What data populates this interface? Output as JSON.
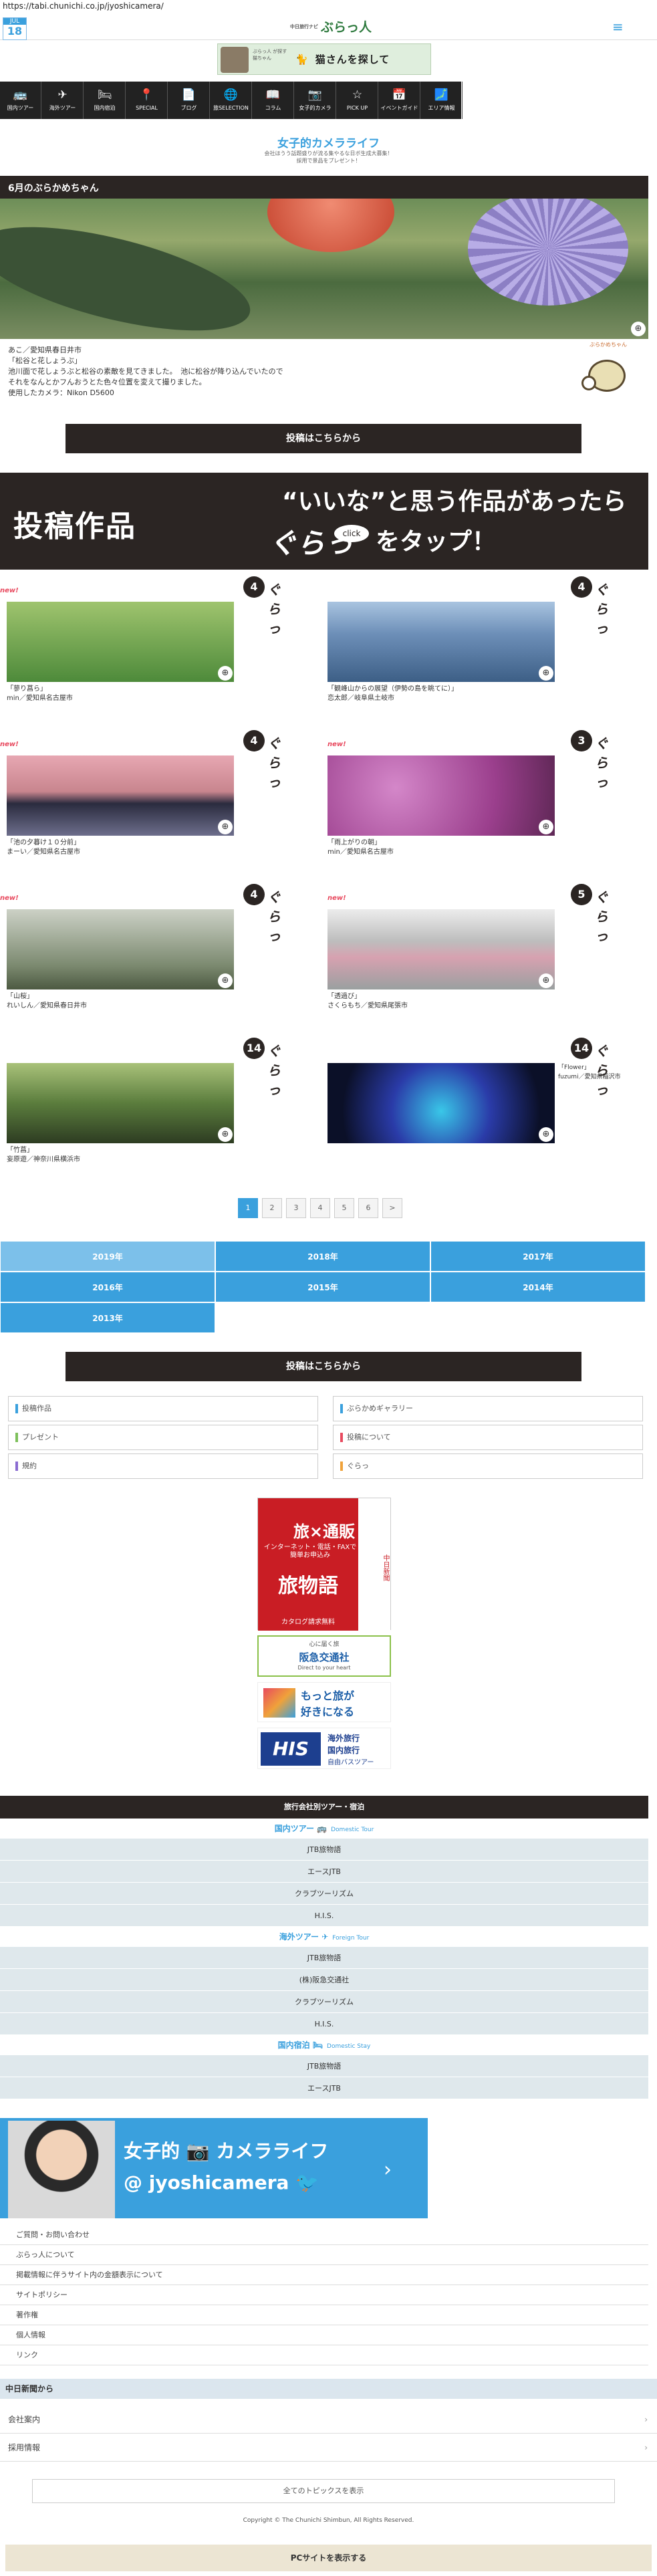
{
  "browser": {
    "url": "https://tabi.chunichi.co.jp/jyoshicamera/"
  },
  "header": {
    "date_month": "JUL",
    "date_day": "18",
    "logo_small": "中日旅行ナビ",
    "logo_main": "ぶらっ人"
  },
  "banner": {
    "small": "ぶらっ人 が探す 猫ちゃん",
    "title": "猫さんを探して",
    "title_prefix": "ぶらっ人"
  },
  "nav": [
    {
      "label": "国内ツアー",
      "icon": "bus-icon"
    },
    {
      "label": "海外ツアー",
      "icon": "plane-icon"
    },
    {
      "label": "国内宿泊",
      "icon": "bed-icon"
    },
    {
      "label": "SPECIAL",
      "icon": "pin-icon"
    },
    {
      "label": "ブログ",
      "icon": "note-icon"
    },
    {
      "label": "旅SELECTION",
      "icon": "globe-icon"
    },
    {
      "label": "コラム",
      "icon": "book-icon"
    },
    {
      "label": "女子的カメラ",
      "icon": "camera-icon"
    },
    {
      "label": "PICK UP",
      "icon": "star-icon"
    },
    {
      "label": "イベントガイド",
      "icon": "calendar-icon"
    },
    {
      "label": "エリア情報",
      "icon": "map-icon"
    }
  ],
  "section": {
    "title": "女子的カメラライフ",
    "sub1": "会社ほうう話題盛りが流る集やるな日ボ生成大募集！",
    "sub2": "採用で景品をプレゼント！"
  },
  "month": {
    "title": "6月のぶらかめちゃん",
    "caption": [
      "あこ／愛知県春日井市",
      "「松谷と花しょうぶ」",
      "池川面で花しょうぶと松谷の素敵を見てきました。　池に松谷が降り込んでいたので",
      "それをなんとかフんおうとた色々位置を変えて撮りました。",
      "使用したカメラ：Nikon D5600"
    ],
    "turtle_text": "ぶらかめちゃん"
  },
  "post_button": "投稿はこちらから",
  "bigbanner": {
    "left": "投稿作品",
    "right1": "“いいな”と思う作品があったら",
    "right2": "ぐらっ",
    "click": "click",
    "right3": "をタップ！"
  },
  "entries": [
    {
      "count": "4",
      "new": "new!",
      "gura": "ぐらっ",
      "caption": "「蓼り菖ら」\nmin／愛知県名古屋市"
    },
    {
      "count": "4",
      "new": "",
      "gura": "ぐらっ",
      "caption": "「観峰山からの展望（伊勢の島を眺てに）」\n恋太郎／岐阜県土岐市"
    },
    {
      "count": "4",
      "new": "new!",
      "gura": "ぐらっ",
      "caption": "「池の夕暮け１０分前」\nまーい／愛知県名古屋市"
    },
    {
      "count": "3",
      "new": "new!",
      "gura": "ぐらっ",
      "caption": "「雨上がりの朝」\nmin／愛知県名古屋市"
    },
    {
      "count": "4",
      "new": "new!",
      "gura": "ぐらっ",
      "caption": "「山桜」\nれいしん／愛知県春日井市"
    },
    {
      "count": "5",
      "new": "new!",
      "gura": "ぐらっ",
      "caption": "「透過び」\nさくらもち／愛知県尾張市"
    },
    {
      "count": "14",
      "new": "",
      "gura": "ぐらっ",
      "caption": "「竹菖」\n妄原遊／神奈川県横浜市"
    },
    {
      "count": "14",
      "new": "",
      "gura": "ぐらっ",
      "caption": "「Flower」\nfuzumi／愛知県稲沢市"
    }
  ],
  "pager": [
    "1",
    "2",
    "3",
    "4",
    "5",
    "6",
    ">"
  ],
  "years": [
    "2019年",
    "2018年",
    "2017年",
    "2016年",
    "2015年",
    "2014年",
    "2013年"
  ],
  "links": [
    {
      "label": "投稿作品",
      "color": "#3aa0dd"
    },
    {
      "label": "ぶらかめギャラリー",
      "color": "#3aa0dd"
    },
    {
      "label": "プレゼント",
      "color": "#7dc05b"
    },
    {
      "label": "投稿について",
      "color": "#e84a5f"
    },
    {
      "label": "規約",
      "color": "#8a6bd1"
    },
    {
      "label": "ぐらっ",
      "color": "#f0a23a"
    }
  ],
  "ads": {
    "jtb1": "旅×通販",
    "jtb2": "インターネット・電話・FAXで簡単お申込み",
    "jtb3": "旅物語",
    "jtb4": "カタログ請求無料",
    "jtb_side": "中日新聞",
    "hankyu1": "心に届く旅",
    "hankyu2": "阪急交通社",
    "hankyu3": "Direct to your heart",
    "club1": "もっと旅が",
    "club2": "好きになる",
    "his1": "HIS",
    "his2": "海外旅行",
    "his3": "国内旅行",
    "his4": "自由バスツアー"
  },
  "tours": {
    "head": "旅行会社別ツアー・宿泊",
    "domestic": {
      "title": "国内ツアー",
      "en": "Domestic Tour",
      "rows": [
        "JTB旅物語",
        "エースJTB",
        "クラブツーリズム",
        "H.I.S."
      ]
    },
    "foreign": {
      "title": "海外ツアー",
      "en": "Foreign Tour",
      "rows": [
        "JTB旅物語",
        "(株)阪急交通社",
        "クラブツーリズム",
        "H.I.S."
      ]
    },
    "stay": {
      "title": "国内宿泊",
      "en": "Domestic Stay",
      "rows": [
        "JTB旅物語",
        "エースJTB"
      ]
    }
  },
  "camban": {
    "t1": "女子的",
    "t1b": "カメラライフ",
    "t2": "@ jyoshicamera"
  },
  "footer_links": [
    "ご質問・お問い合わせ",
    "ぶらっ人について",
    "掲載情報に伴うサイト内の金額表示について",
    "サイトポリシー",
    "著作権",
    "個人情報",
    "リンク"
  ],
  "footer_section": "中日新聞から",
  "footer_rows": [
    "会社案内",
    "採用情報"
  ],
  "all_topics": "全てのトピックスを表示",
  "copyright": "Copyright © The Chunichi Shimbun, All Rights Reserved.",
  "pc_button": "PCサイトを表示する",
  "colors": {
    "accent": "#3aa0dd",
    "dark": "#2b2523",
    "pink": "#e84a5f"
  }
}
